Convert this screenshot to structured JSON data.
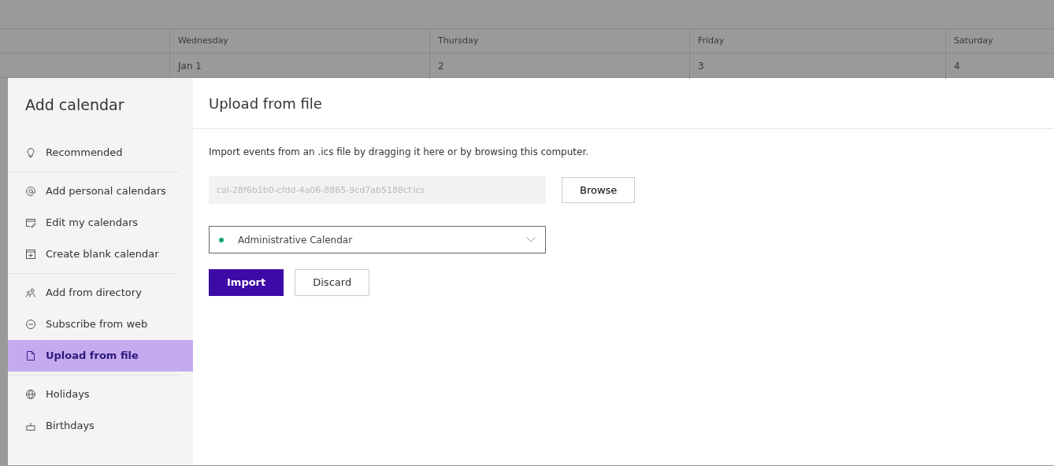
{
  "calendar": {
    "days": [
      {
        "name": "Wednesday",
        "date": "Jan 1"
      },
      {
        "name": "Thursday",
        "date": "2"
      },
      {
        "name": "Friday",
        "date": "3"
      },
      {
        "name": "Saturday",
        "date": "4"
      }
    ]
  },
  "sidebar": {
    "title": "Add calendar",
    "sections": [
      {
        "items": [
          {
            "label": "Recommended",
            "kind": "bulb",
            "selected": false
          }
        ]
      },
      {
        "items": [
          {
            "label": "Add personal calendars",
            "kind": "at",
            "selected": false
          },
          {
            "label": "Edit my calendars",
            "kind": "edit",
            "selected": false
          },
          {
            "label": "Create blank calendar",
            "kind": "plus",
            "selected": false
          }
        ]
      },
      {
        "items": [
          {
            "label": "Add from directory",
            "kind": "people",
            "selected": false
          },
          {
            "label": "Subscribe from web",
            "kind": "link",
            "selected": false
          },
          {
            "label": "Upload from file",
            "kind": "file",
            "selected": true
          }
        ]
      },
      {
        "items": [
          {
            "label": "Holidays",
            "kind": "globe",
            "selected": false
          },
          {
            "label": "Birthdays",
            "kind": "cake",
            "selected": false
          }
        ]
      }
    ]
  },
  "panel": {
    "title": "Upload from file",
    "description": "Import events from an .ics file by dragging it here or by browsing this computer.",
    "file_field": {
      "value": "cal-28f6b1b0-cfdd-4a06-8865-9cd7ab5188cf.ics"
    },
    "browse_button": "Browse",
    "calendar_select": {
      "value": "Administrative Calendar",
      "color": "#13a86b"
    },
    "buttons": [
      {
        "label": "Import",
        "kind": "primary"
      },
      {
        "label": "Discard",
        "kind": "secondary"
      }
    ]
  }
}
